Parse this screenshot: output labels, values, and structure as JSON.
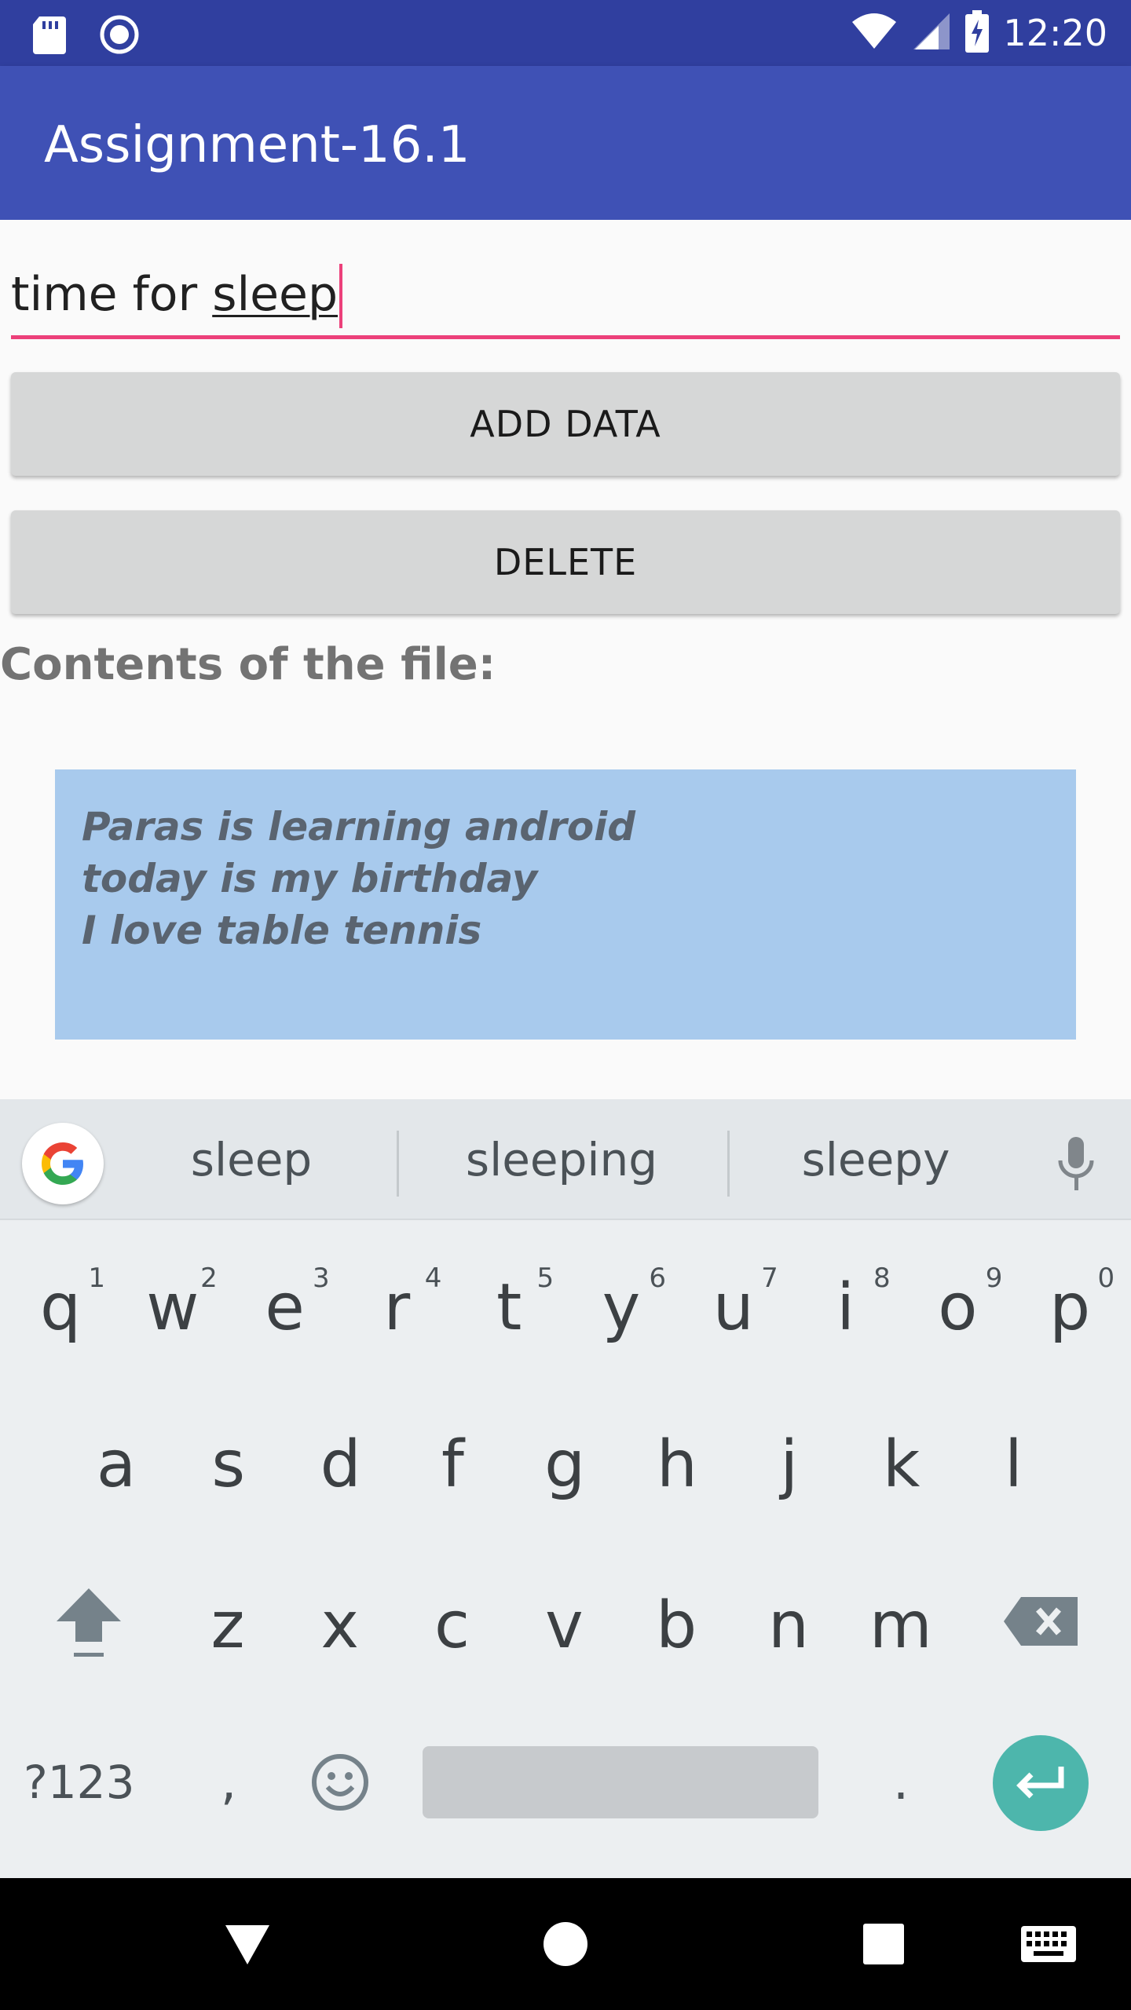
{
  "status_bar": {
    "time": "12:20",
    "left_icons": [
      "sd-card-icon",
      "sync-circle-icon"
    ],
    "right_icons": [
      "wifi-icon",
      "cell-signal-icon",
      "battery-charging-icon"
    ]
  },
  "app_bar": {
    "title": "Assignment-16.1",
    "color": "#3f51b5",
    "status_color": "#303f9f"
  },
  "input": {
    "value_prefix": "time for ",
    "value_composing": "sleep",
    "accent_color": "#ec407a"
  },
  "buttons": {
    "add_label": "ADD DATA",
    "delete_label": "DELETE"
  },
  "contents_label": "Contents of the file:",
  "file_contents": [
    "Paras is learning android",
    "today is my birthday",
    "I love table tennis"
  ],
  "keyboard": {
    "suggestions": [
      "sleep",
      "sleeping",
      "sleepy"
    ],
    "row1": [
      {
        "key": "q",
        "hint": "1"
      },
      {
        "key": "w",
        "hint": "2"
      },
      {
        "key": "e",
        "hint": "3"
      },
      {
        "key": "r",
        "hint": "4"
      },
      {
        "key": "t",
        "hint": "5"
      },
      {
        "key": "y",
        "hint": "6"
      },
      {
        "key": "u",
        "hint": "7"
      },
      {
        "key": "i",
        "hint": "8"
      },
      {
        "key": "o",
        "hint": "9"
      },
      {
        "key": "p",
        "hint": "0"
      }
    ],
    "row2": [
      "a",
      "s",
      "d",
      "f",
      "g",
      "h",
      "j",
      "k",
      "l"
    ],
    "row3": [
      "z",
      "x",
      "c",
      "v",
      "b",
      "n",
      "m"
    ],
    "symbols_label": "?123",
    "comma": ",",
    "period": ".",
    "enter_color": "#4db6ac"
  },
  "nav_bar": {
    "icons": [
      "back-icon",
      "home-icon",
      "recents-icon",
      "keyboard-switch-icon"
    ]
  }
}
